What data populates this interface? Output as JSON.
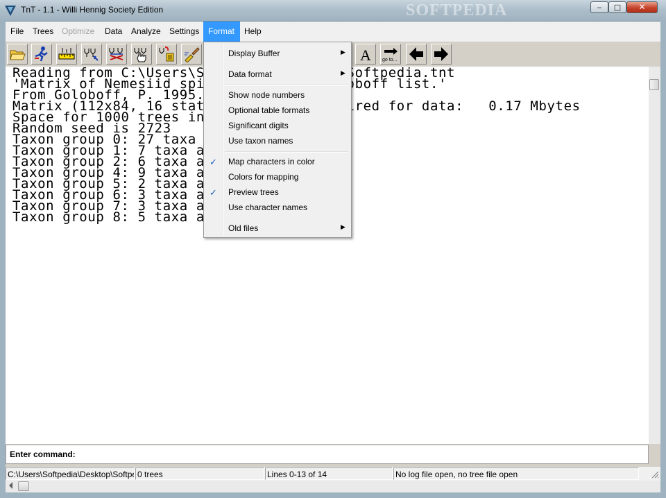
{
  "window": {
    "title": "TnT - 1.1 - Willi Hennig Society Edition",
    "watermark": "SOFTPEDIA",
    "minimize_glyph": "‒",
    "maximize_glyph": "□",
    "close_glyph": "✕"
  },
  "menubar": {
    "items": [
      {
        "label": "File",
        "enabled": true
      },
      {
        "label": "Trees",
        "enabled": true
      },
      {
        "label": "Optimize",
        "enabled": false
      },
      {
        "label": "Data",
        "enabled": true
      },
      {
        "label": "Analyze",
        "enabled": true
      },
      {
        "label": "Settings",
        "enabled": true
      },
      {
        "label": "Format",
        "enabled": true,
        "active": true
      },
      {
        "label": "Help",
        "enabled": true
      }
    ]
  },
  "toolbar": {
    "buttons": [
      {
        "icon": "open-folder-icon"
      },
      {
        "icon": "running-man-icon"
      },
      {
        "icon": "ruler-icon"
      },
      {
        "icon": "tree-search-icon"
      },
      {
        "icon": "tree-swap-icon"
      },
      {
        "icon": "tree-hand-icon"
      },
      {
        "icon": "tree-delete-icon"
      },
      {
        "icon": "brush-icon"
      },
      {
        "icon": "font-icon",
        "text": "A"
      },
      {
        "icon": "goto-icon",
        "text": "go to..."
      },
      {
        "icon": "arrow-left-icon"
      },
      {
        "icon": "arrow-right-icon"
      }
    ]
  },
  "output": {
    "lines": [
      "Reading from C:\\Users\\Softpedia\\Desktop\\Softpedia.tnt",
      "'Matrix of Nemesiid spiders, from R. Goloboff list.'",
      "From Goloboff, P. 1995.",
      "Matrix (112x84, 16 states).  Memory required for data:   0.17 Mbytes",
      "Space for 1000 trees in memory",
      "Random seed is 2723",
      "Taxon group 0: 27 taxa",
      "Taxon group 1: 7 taxa a",
      "Taxon group 2: 6 taxa a",
      "Taxon group 4: 9 taxa a",
      "Taxon group 5: 2 taxa a",
      "Taxon group 6: 3 taxa a",
      "Taxon group 7: 3 taxa a",
      "Taxon group 8: 5 taxa a"
    ]
  },
  "command": {
    "label": "Enter command:",
    "value": ""
  },
  "status": {
    "file": "C:\\Users\\Softpedia\\Desktop\\Softpedia.tnt",
    "trees": "0 trees",
    "lines": "Lines 0-13 of 14",
    "log": "No log file open, no tree file open"
  },
  "format_menu": {
    "items": [
      {
        "label": "Display Buffer",
        "submenu": true,
        "checked": false
      },
      {
        "label": "Data format",
        "submenu": true,
        "checked": false
      },
      {
        "label": "Show node numbers",
        "submenu": false,
        "checked": false
      },
      {
        "label": "Optional table formats",
        "submenu": false,
        "checked": false
      },
      {
        "label": "Significant digits",
        "submenu": false,
        "checked": false
      },
      {
        "label": "Use taxon names",
        "submenu": false,
        "checked": false
      },
      {
        "label": "Map characters in color",
        "submenu": false,
        "checked": true
      },
      {
        "label": "Colors for mapping",
        "submenu": false,
        "checked": false
      },
      {
        "label": "Preview trees",
        "submenu": false,
        "checked": true
      },
      {
        "label": "Use character names",
        "submenu": false,
        "checked": false
      },
      {
        "label": "Old files",
        "submenu": true,
        "checked": false
      }
    ],
    "check_glyph": "✓",
    "submenu_glyph": "▶"
  }
}
